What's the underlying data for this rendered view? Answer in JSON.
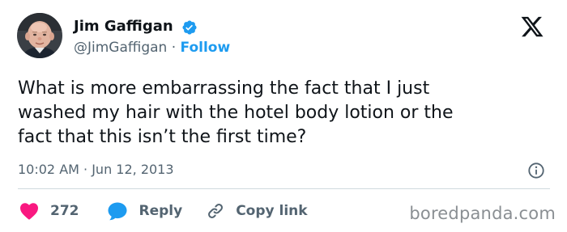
{
  "author": {
    "name": "Jim Gaffigan",
    "handle": "@JimGaffigan",
    "separator": "·",
    "follow_label": "Follow",
    "avatar_icon": "profile-photo",
    "verified_icon": "verified-badge-icon"
  },
  "platform": {
    "logo_icon": "x-logo-icon"
  },
  "tweet": {
    "text": "What is more embarrassing the fact that I just\nwashed my hair with the hotel body lotion or the\nfact that this isn’t the first time?",
    "timestamp": "10:02 AM · Jun 12, 2013"
  },
  "actions": {
    "like_count": "272",
    "reply_label": "Reply",
    "copy_link_label": "Copy link"
  },
  "watermark": {
    "text": "boredpanda.com"
  },
  "colors": {
    "accent": "#1d9bf0",
    "like": "#f91880",
    "text_primary": "#0f1419",
    "text_secondary": "#536471",
    "divider": "#cfd9de"
  }
}
